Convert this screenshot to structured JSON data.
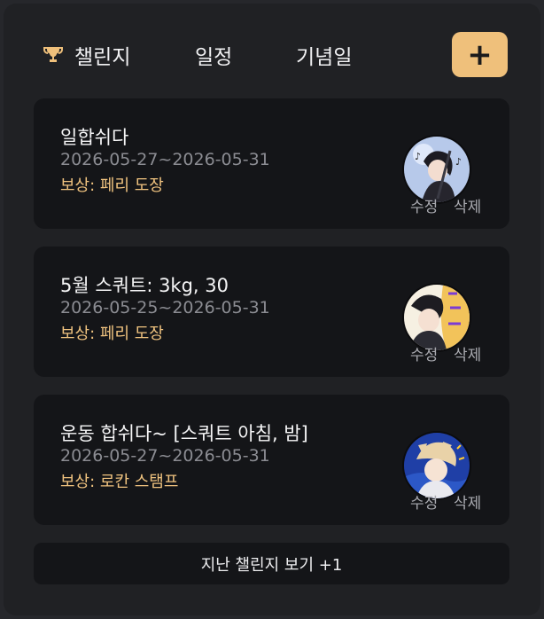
{
  "tabs": [
    {
      "label": "챌린지",
      "icon": "trophy-icon",
      "active": true
    },
    {
      "label": "일정",
      "active": false
    },
    {
      "label": "기념일",
      "active": false
    }
  ],
  "add_button": {
    "label": "+"
  },
  "challenges": [
    {
      "title": "일합쉬다",
      "dates": "2026-05-27~2026-05-31",
      "reward": "보상: 페리 도장",
      "edit_label": "수정",
      "delete_label": "삭제"
    },
    {
      "title": "5월 스쿼트: 3kg, 30",
      "dates": "2026-05-25~2026-05-31",
      "reward": "보상: 페리 도장",
      "edit_label": "수정",
      "delete_label": "삭제"
    },
    {
      "title": "운동 합쉬다~ [스쿼트 아침, 밤]",
      "dates": "2026-05-27~2026-05-31",
      "reward": "보상: 로칸 스탬프",
      "edit_label": "수정",
      "delete_label": "삭제"
    }
  ],
  "past_challenges_button": {
    "label": "지난 챌린지 보기 +1"
  },
  "colors": {
    "accent": "#efc07b",
    "card_bg": "#141518",
    "reward_text": "#f0c37f"
  }
}
